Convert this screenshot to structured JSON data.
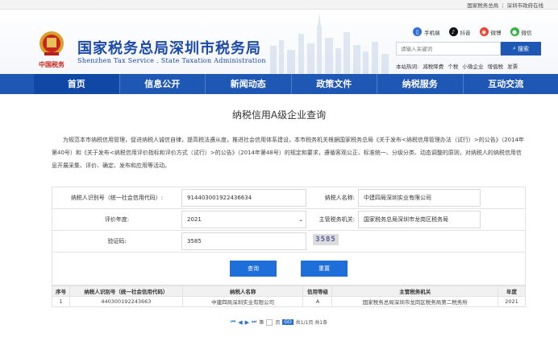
{
  "toplinks": [
    "国家税务总局",
    "深圳市政府在线"
  ],
  "header": {
    "title": "国家税务总局深圳市税务局",
    "subtitle": "Shenzhen Tax Service . State Taxation Administration",
    "emblem_text": "中国税务"
  },
  "social": [
    {
      "icon": "mobile-icon",
      "label": "手机端",
      "color": "#2d6fd2"
    },
    {
      "icon": "douyin-icon",
      "label": "抖音",
      "color": "#111111"
    },
    {
      "icon": "weibo-icon",
      "label": "微博",
      "color": "#e8432d"
    },
    {
      "icon": "wechat-icon",
      "label": "微信",
      "color": "#2fb33a"
    }
  ],
  "search": {
    "placeholder": "请输入关键词",
    "button": "搜索",
    "hot_label": "本站热词:",
    "hot_words": [
      "减税降费",
      "个税",
      "小微企业",
      "增值税",
      "发票"
    ]
  },
  "nav": [
    "首页",
    "信息公开",
    "新闻动态",
    "政策文件",
    "纳税服务",
    "互动交流"
  ],
  "page_title": "纳税信用A级企业查询",
  "intro": "为规范本市纳税信用管理，促进纳税人诚信自律，提高税法遵从度，推进社会信用体系建设，本市税务机关根据国家税务总局《关于发布<纳税信用管理办法（试行）>的公告》（2014年第40号）和《关于发布<纳税信用评价指标和评价方式（试行）>的公告》（2014年第48号）的规定和要求，遵循客观公正、标准统一、分级分类、动态调整的原则，对纳税人的纳税信用信息开展采集、评价、确定、发布和应用等活动。",
  "form": {
    "taxpayer_id_label": "纳税人识别号（统一社会信用代码）:",
    "taxpayer_id_value": "914403001922436634",
    "taxpayer_name_label": "纳税人名称:",
    "taxpayer_name_value": "中建四局深圳实业有限公司",
    "year_label": "评价年度:",
    "year_value": "2021",
    "authority_label": "主管税务机关:",
    "authority_value": "国家税务总局深圳市龙岗区税务局",
    "captcha_label": "验证码:",
    "captcha_value": "3585",
    "captcha_image_text": "3585",
    "query_button": "查询",
    "reset_button": "重置"
  },
  "table": {
    "headers": [
      "序号",
      "纳税人识别号（统一社会信用代码）",
      "纳税人名称",
      "信用等级",
      "主管税务机关",
      "年度"
    ],
    "rows": [
      [
        "1",
        "440300192243663",
        "中建四局深圳实业有限公司",
        "A",
        "国家税务总局深圳市龙岗区税务局第二税务所",
        "2021"
      ]
    ]
  },
  "pager": {
    "page_prefix": "第",
    "page_suffix": "页",
    "go": "GO",
    "summary": "共1/1页 共1条"
  }
}
